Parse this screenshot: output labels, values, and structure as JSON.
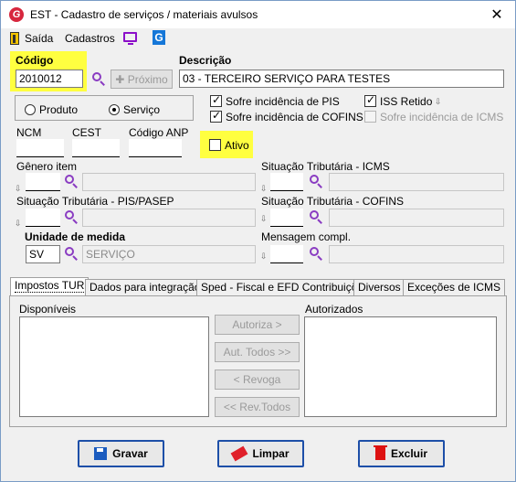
{
  "window": {
    "title": "EST - Cadastro de serviços / materiais avulsos",
    "close": "✕"
  },
  "menu": {
    "exit": "Saída",
    "registrations": "Cadastros"
  },
  "code": {
    "label": "Código",
    "value": "2010012",
    "next_button": "Próximo"
  },
  "description": {
    "label": "Descrição",
    "value": "03 - TERCEIRO SERVIÇO PARA TESTES"
  },
  "type": {
    "product": "Produto",
    "service": "Serviço",
    "selected": "Serviço"
  },
  "checks": {
    "pis": "Sofre incidência de PIS",
    "cofins": "Sofre incidência de COFINS",
    "iss": "ISS Retido",
    "icms": "Sofre incidência de ICMS",
    "active": "Ativo"
  },
  "fields": {
    "ncm": "NCM",
    "cest": "CEST",
    "anp": "Código ANP",
    "genero": "Gênero item",
    "sit_icms": "Situação Tributária - ICMS",
    "sit_pis": "Situação Tributária - PIS/PASEP",
    "sit_cofins": "Situação Tributária - COFINS",
    "unidade": "Unidade de medida",
    "unidade_code": "SV",
    "unidade_desc": "SERVIÇO",
    "mensagem": "Mensagem compl."
  },
  "tabs": [
    "Impostos TUR",
    "Dados para integração",
    "Sped - Fiscal e EFD Contribuições",
    "Diversos",
    "Exceções de ICMS"
  ],
  "panel": {
    "available": "Disponíveis",
    "authorized": "Autorizados",
    "authorize": "Autoriza >",
    "authorize_all": "Aut. Todos >>",
    "revoke": "< Revoga",
    "revoke_all": "<< Rev.Todos"
  },
  "actions": {
    "save": "Gravar",
    "clear": "Limpar",
    "delete": "Excluir"
  },
  "colors": {
    "highlight": "#ffff40",
    "accent": "#1d4fa8",
    "search": "#8a3cc2"
  }
}
